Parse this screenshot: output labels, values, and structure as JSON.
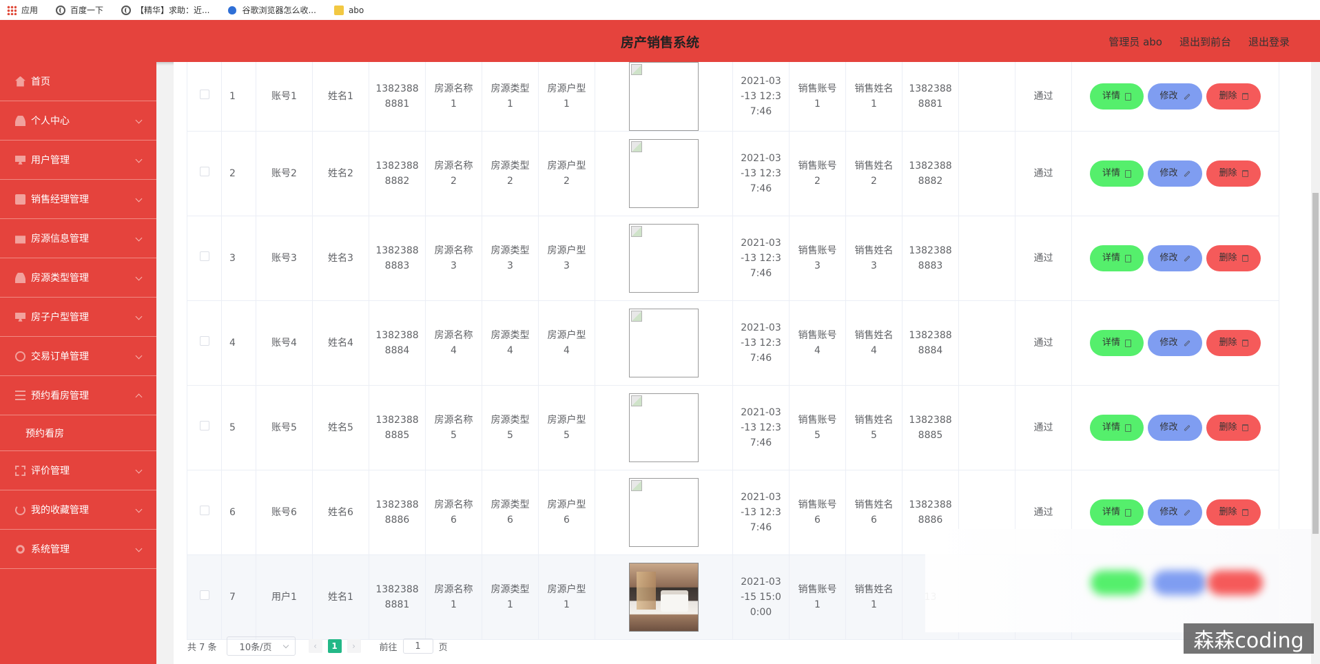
{
  "bookmarks": [
    {
      "label": "应用",
      "icon": "apps-grid-icon"
    },
    {
      "label": "百度一下",
      "icon": "globe-icon"
    },
    {
      "label": "【精华】求助：近...",
      "icon": "globe-icon"
    },
    {
      "label": "谷歌浏览器怎么收...",
      "icon": "baidu-paw-icon"
    },
    {
      "label": "abo",
      "icon": "folder-icon"
    }
  ],
  "header": {
    "title": "房产销售系统",
    "admin": "管理员 abo",
    "to_front": "退出到前台",
    "logout": "退出登录"
  },
  "sidebar": {
    "items": [
      {
        "label": "首页",
        "icon": "home-icon"
      },
      {
        "label": "个人中心",
        "icon": "user-icon"
      },
      {
        "label": "用户管理",
        "icon": "monitor-icon"
      },
      {
        "label": "销售经理管理",
        "icon": "clipboard-icon"
      },
      {
        "label": "房源信息管理",
        "icon": "briefcase-icon"
      },
      {
        "label": "房源类型管理",
        "icon": "user-icon"
      },
      {
        "label": "房子户型管理",
        "icon": "monitor-icon"
      },
      {
        "label": "交易订单管理",
        "icon": "ring-icon"
      },
      {
        "label": "预约看房管理",
        "icon": "list-icon",
        "expanded": true
      },
      {
        "label": "评价管理",
        "icon": "fullscreen-icon"
      },
      {
        "label": "我的收藏管理",
        "icon": "power-icon"
      },
      {
        "label": "系统管理",
        "icon": "gear-icon"
      }
    ],
    "submenu": {
      "label": "预约看房"
    }
  },
  "table": {
    "rows": [
      {
        "index": "1",
        "account": "账号1",
        "name": "姓名1",
        "phone": "13823888881",
        "house_name": "房源名称1",
        "house_type": "房源类型1",
        "layout": "房源户型1",
        "time": "2021-03-13 12:37:46",
        "sales_account": "销售账号1",
        "sales_name": "销售姓名1",
        "sales_phone": "13823888881",
        "status": "通过",
        "image": "broken"
      },
      {
        "index": "2",
        "account": "账号2",
        "name": "姓名2",
        "phone": "13823888882",
        "house_name": "房源名称2",
        "house_type": "房源类型2",
        "layout": "房源户型2",
        "time": "2021-03-13 12:37:46",
        "sales_account": "销售账号2",
        "sales_name": "销售姓名2",
        "sales_phone": "13823888882",
        "status": "通过",
        "image": "broken"
      },
      {
        "index": "3",
        "account": "账号3",
        "name": "姓名3",
        "phone": "13823888883",
        "house_name": "房源名称3",
        "house_type": "房源类型3",
        "layout": "房源户型3",
        "time": "2021-03-13 12:37:46",
        "sales_account": "销售账号3",
        "sales_name": "销售姓名3",
        "sales_phone": "13823888883",
        "status": "通过",
        "image": "broken"
      },
      {
        "index": "4",
        "account": "账号4",
        "name": "姓名4",
        "phone": "13823888884",
        "house_name": "房源名称4",
        "house_type": "房源类型4",
        "layout": "房源户型4",
        "time": "2021-03-13 12:37:46",
        "sales_account": "销售账号4",
        "sales_name": "销售姓名4",
        "sales_phone": "13823888884",
        "status": "通过",
        "image": "broken"
      },
      {
        "index": "5",
        "account": "账号5",
        "name": "姓名5",
        "phone": "13823888885",
        "house_name": "房源名称5",
        "house_type": "房源类型5",
        "layout": "房源户型5",
        "time": "2021-03-13 12:37:46",
        "sales_account": "销售账号5",
        "sales_name": "销售姓名5",
        "sales_phone": "13823888885",
        "status": "通过",
        "image": "broken"
      },
      {
        "index": "6",
        "account": "账号6",
        "name": "姓名6",
        "phone": "13823888886",
        "house_name": "房源名称6",
        "house_type": "房源类型6",
        "layout": "房源户型6",
        "time": "2021-03-13 12:37:46",
        "sales_account": "销售账号6",
        "sales_name": "销售姓名6",
        "sales_phone": "13823888886",
        "status": "通过",
        "image": "broken"
      },
      {
        "index": "7",
        "account": "用户1",
        "name": "姓名1",
        "phone": "13823888881",
        "house_name": "房源名称1",
        "house_type": "房源类型1",
        "layout": "房源户型1",
        "time": "2021-03-15 15:00:00",
        "sales_account": "销售账号1",
        "sales_name": "销售姓名1",
        "sales_phone": "13",
        "status": "",
        "image": "photo"
      }
    ],
    "buttons": {
      "detail": "详情",
      "edit": "修改",
      "delete": "删除"
    }
  },
  "pagination": {
    "total": "共 7 条",
    "page_size": "10条/页",
    "current_page": "1",
    "goto_label": "前往",
    "goto_value": "1",
    "goto_suffix": "页"
  },
  "watermark": "森森coding",
  "colors": {
    "header_red": "#e5433d",
    "detail_green": "#55ef6c",
    "edit_blue": "#7f9df1",
    "delete_red": "#f55a5a",
    "page_active": "#23b887"
  }
}
